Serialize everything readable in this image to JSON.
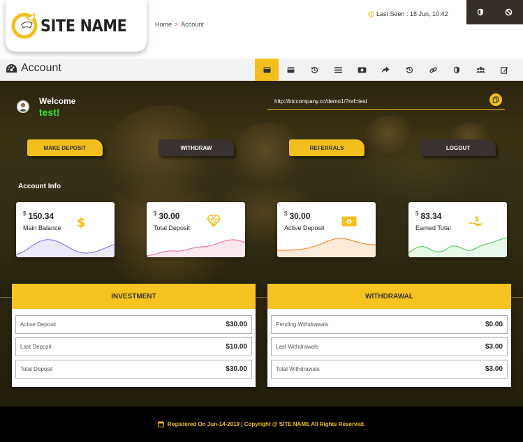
{
  "brand": {
    "name": "SITE NAME"
  },
  "breadcrumb": {
    "home": "Home",
    "separator": ">",
    "current": "Account"
  },
  "header": {
    "last_seen": "Last Seen : 18 Jun, 10:42"
  },
  "page": {
    "title": "Account"
  },
  "welcome": {
    "greeting": "Welcome",
    "username": "test!"
  },
  "referral": {
    "url": "http://btccompany.cc/demo1/?ref=test"
  },
  "actions": {
    "deposit": "MAKE DEPOSIT",
    "withdraw": "WITHDRAW",
    "referrals": "REFERRALS",
    "logout": "LOGOUT"
  },
  "account_info": {
    "heading": "Account Info",
    "cards": [
      {
        "currency": "$",
        "amount": "150.34",
        "label": "Main Balance",
        "icon": "dollar-icon",
        "color": "#8a7fe6"
      },
      {
        "currency": "$",
        "amount": "30.00",
        "label": "Total Deposit",
        "icon": "diamond-icon",
        "color": "#e87aa0"
      },
      {
        "currency": "$",
        "amount": "30.00",
        "label": "Active Deposit",
        "icon": "cash-icon",
        "color": "#f08a2a"
      },
      {
        "currency": "$",
        "amount": "83.34",
        "label": "Earned Total",
        "icon": "hand-dollar-icon",
        "color": "#5ed16a"
      }
    ]
  },
  "investment": {
    "title": "INVESTMENT",
    "rows": [
      {
        "label": "Active Deposit",
        "value": "$30.00"
      },
      {
        "label": "Last Deposit",
        "value": "$10.00"
      },
      {
        "label": "Total Deposit",
        "value": "$30.00"
      }
    ]
  },
  "withdrawal": {
    "title": "WITHDRAWAL",
    "rows": [
      {
        "label": "Pending Withdrawals",
        "value": "$0.00"
      },
      {
        "label": "Last Withdrawals",
        "value": "$3.00"
      },
      {
        "label": "Total Withdrawals",
        "value": "$3.00"
      }
    ]
  },
  "nav_icons": [
    "wallet-icon",
    "card-icon",
    "history-icon",
    "list-icon",
    "money-icon",
    "share-icon",
    "history-icon",
    "link-icon",
    "shield-icon",
    "users-icon",
    "edit-icon"
  ],
  "footer": {
    "text": "Registered On Jun-14-2019 | Copyright @ SITE NAME All Rights Reserved."
  },
  "colors": {
    "accent": "#f3bf1d",
    "dark": "#37302a",
    "success": "#39e639"
  }
}
